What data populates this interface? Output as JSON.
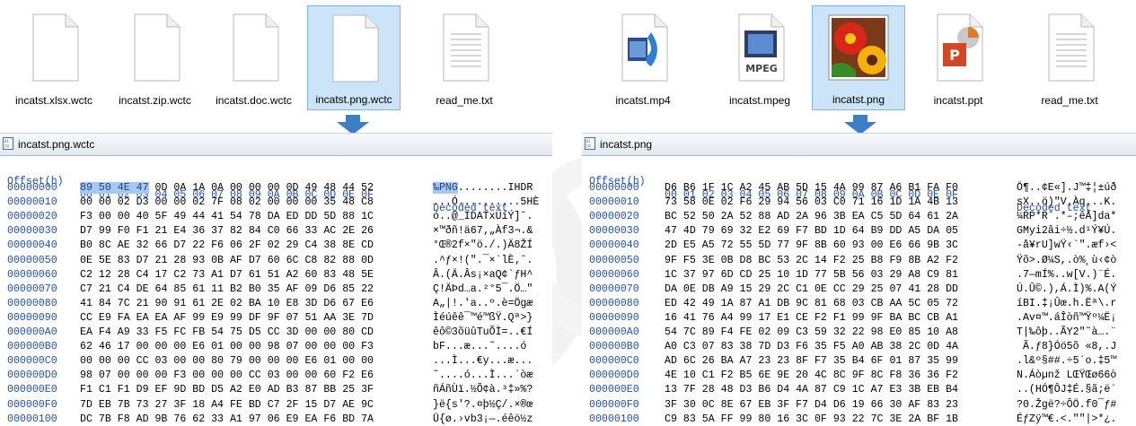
{
  "left": {
    "files": [
      {
        "name": "incatst.xlsx.wctc",
        "type": "blank"
      },
      {
        "name": "incatst.zip.wctc",
        "type": "blank"
      },
      {
        "name": "incatst.doc.wctc",
        "type": "blank"
      },
      {
        "name": "incatst.png.wctc",
        "type": "blank",
        "selected": true
      },
      {
        "name": "read_me.txt",
        "type": "text"
      }
    ],
    "tab_label": "incatst.png.wctc",
    "header": {
      "offset": "Offset(h)",
      "bytes": "00 01 02 03 04 05 06 07 08 09 0A 0B 0C 0D 0E 0F",
      "decoded": "Decoded text"
    },
    "rows": [
      {
        "off": "00000000",
        "hex": "89 50 4E 47 0D 0A 1A 0A 00 00 00 0D 49 48 44 52",
        "dec": "‰PNG........IHDR"
      },
      {
        "off": "00000010",
        "hex": "00 00 02 D3 00 00 02 7F 08 02 00 00 00 35 48 C8",
        "dec": "...Ó..........5HÈ"
      },
      {
        "off": "00000020",
        "hex": "F3 00 00 40 5F 49 44 41 54 78 DA ED DD 5D 88 1C",
        "dec": "ó..@_IDATxÚíÝ]ˆ."
      },
      {
        "off": "00000030",
        "hex": "D7 99 F0 F1 21 E4 36 37 82 84 C0 66 33 AC 2E 26",
        "dec": "×™ðñ!ä67‚„Àf3¬.&"
      },
      {
        "off": "00000040",
        "hex": "B0 8C AE 32 66 D7 22 F6 06 2F 02 29 C4 38 8E CD",
        "dec": "°Œ®2f×\"ö./.)Ä8ŽÍ"
      },
      {
        "off": "00000050",
        "hex": "0E 5E 83 D7 21 28 93 0B AF D7 60 6C C8 82 88 0D",
        "dec": ".^ƒ×!(\".¯×`lÈ‚ˆ."
      },
      {
        "off": "00000060",
        "hex": "C2 12 28 C4 17 C2 73 A1 D7 61 51 A2 60 83 48 5E",
        "dec": "Â.(Ä.Âs¡×aQ¢`ƒH^"
      },
      {
        "off": "00000070",
        "hex": "C7 21 C4 DE 64 85 61 11 B2 B0 35 AF 09 D6 85 22",
        "dec": "Ç!ÄÞd…a.²°5¯.Ö…\""
      },
      {
        "off": "00000080",
        "hex": "41 84 7C 21 90 91 61 2E 02 BA 10 E8 3D D6 67 E6",
        "dec": "A„|!.'a..º.è=Ögæ"
      },
      {
        "off": "00000090",
        "hex": "CC E9 FA EA EA AF 99 E9 99 DF 9F 07 51 AA 3E 7D",
        "dec": "Ìéúêê¯™é™ßŸ.Qª>}"
      },
      {
        "off": "000000A0",
        "hex": "EA F4 A9 33 F5 FC FB 54 75 D5 CC 3D 00 00 80 CD",
        "dec": "êô©3õüûTuÕÌ=..€Í"
      },
      {
        "off": "000000B0",
        "hex": "62 46 17 00 00 00 E6 01 00 00 98 07 00 00 00 F3",
        "dec": "bF...æ...˜....ó"
      },
      {
        "off": "000000C0",
        "hex": "00 00 00 CC 03 00 00 80 79 00 00 00 E6 01 00 00",
        "dec": "...Ì...€y...æ..."
      },
      {
        "off": "000000D0",
        "hex": "98 07 00 00 00 F3 00 00 00 CC 03 00 00 60 F2 E6",
        "dec": "˜....ó...Ì...`òæ"
      },
      {
        "off": "000000E0",
        "hex": "F1 C1 F1 D9 EF 9D BD D5 A2 E0 AD B3 87 BB 25 3F",
        "dec": "ñÁñÙï.½Õ¢à.³‡»%?"
      },
      {
        "off": "000000F0",
        "hex": "7D EB 7B 73 27 3F 18 A4 FE BD C7 2F 15 D7 AE 9C",
        "dec": "}ë{s'?.¤þ½Ç/.×®œ"
      },
      {
        "off": "00000100",
        "hex": "DC 7B F8 AD 9B 76 62 33 A1 97 06 E9 EA F6 BD 7A",
        "dec": "Ü{ø.›vb3¡—.éêö½z"
      }
    ]
  },
  "right": {
    "files": [
      {
        "name": "incatst.mp4",
        "type": "mp4"
      },
      {
        "name": "incatst.mpeg",
        "type": "mpeg",
        "badge": "MPEG"
      },
      {
        "name": "incatst.png",
        "type": "png",
        "selected": true
      },
      {
        "name": "incatst.ppt",
        "type": "ppt"
      },
      {
        "name": "read_me.txt",
        "type": "text"
      }
    ],
    "tab_label": "incatst.png",
    "header": {
      "offset": "Offset(h)",
      "bytes": "00 01 02 03 04 05 06 07 08 09 0A 0B 0C 0D 0E 0F",
      "decoded": "Decoded text"
    },
    "rows": [
      {
        "off": "00000000",
        "hex": "D6 B6 1F 1C A2 45 AB 5D 15 4A 99 87 A6 B1 FA F0",
        "dec": "Ö¶..¢E«].J™‡¦±úð"
      },
      {
        "off": "00000010",
        "hex": "73 58 0E 02 F6 29 94 56 03 C0 71 16 1D 1A 4B 13",
        "dec": "sX..ö)\"V.Àq...K."
      },
      {
        "off": "00000020",
        "hex": "BC 52 50 2A 52 88 AD 2A 96 3B EA C5 5D 64 61 2A",
        "dec": "¼RP*Rˆ.*–;êÅ]da*"
      },
      {
        "off": "00000030",
        "hex": "47 4D 79 69 32 E2 69 F7 BD 1D 64 B9 DD A5 DA 05",
        "dec": "GMyi2âi÷½.d¹Ý¥Ú."
      },
      {
        "off": "00000040",
        "hex": "2D E5 A5 72 55 5D 77 9F 8B 60 93 00 E6 66 9B 3C",
        "dec": "-å¥rU]wŸ‹`\".æf›<"
      },
      {
        "off": "00000050",
        "hex": "9F F5 3E 0B D8 BC 53 2C 14 F2 25 B8 F9 8B A2 F2",
        "dec": "Ÿõ>.Ø¼S,.ò%¸ù‹¢ò"
      },
      {
        "off": "00000060",
        "hex": "1C 37 97 6D CD 25 10 1D 77 5B 56 03 29 A8 C9 81",
        "dec": ".7—mÍ%..w[V.)¨É."
      },
      {
        "off": "00000070",
        "hex": "DA 0E DB A9 15 29 2C C1 0E CC 29 25 07 41 28 DD",
        "dec": "Ú.Û©.),Á.Ì)%.A(Ý"
      },
      {
        "off": "00000080",
        "hex": "ED 42 49 1A 87 A1 DB 9C 81 68 03 CB AA 5C 05 72",
        "dec": "íBI.‡¡Ûœ.h.Ëª\\.r"
      },
      {
        "off": "00000090",
        "hex": "16 41 76 A4 99 17 E1 CE F2 F1 99 9F BA BC CB A1",
        "dec": ".Av¤™.áÎòñ™Ÿº¼Ë¡"
      },
      {
        "off": "000000A0",
        "hex": "54 7C 89 F4 FE 02 09 C3 59 32 22 98 E0 85 10 A8",
        "dec": "T|‰ôþ..ÃY2\"˜à….¨"
      },
      {
        "off": "000000B0",
        "hex": "A0 C3 07 83 38 7D D3 F6 35 F5 A0 AB 38 2C 0D 4A",
        "dec": " Ã.ƒ8}Óö5õ «8,.J"
      },
      {
        "off": "000000C0",
        "hex": "AD 6C 26 BA A7 23 23 8F F7 35 B4 6F 01 87 35 99",
        "dec": ".l&º§##.÷5´o.‡5™"
      },
      {
        "off": "000000D0",
        "hex": "4E 10 C1 F2 B5 6E 9E 20 4C 8C 9F 8C F8 36 36 F2",
        "dec": "N.Áòµnž LŒŸŒø66ò"
      },
      {
        "off": "000000E0",
        "hex": "13 7F 28 48 D3 B6 D4 4A 87 C9 1C A7 E3 3B EB B4",
        "dec": "..(HÓ¶ÔJ‡É.§ã;ë´"
      },
      {
        "off": "000000F0",
        "hex": "3F 30 0C 8E 67 EB 3F F7 D4 D6 19 66 30 AF 83 23",
        "dec": "?0.Žgë?÷ÔÖ.f0¯ƒ#"
      },
      {
        "off": "00000100",
        "hex": "C9 83 5A FF 99 80 16 3C 0F 93 22 7C 3E 2A BF 1B",
        "dec": "ÉƒZÿ™€.<.\"\"|>*¿."
      }
    ]
  },
  "colors": {
    "accent": "#1f4fb0",
    "selection": "#cce4f7",
    "arrow": "#3c7fc7"
  }
}
